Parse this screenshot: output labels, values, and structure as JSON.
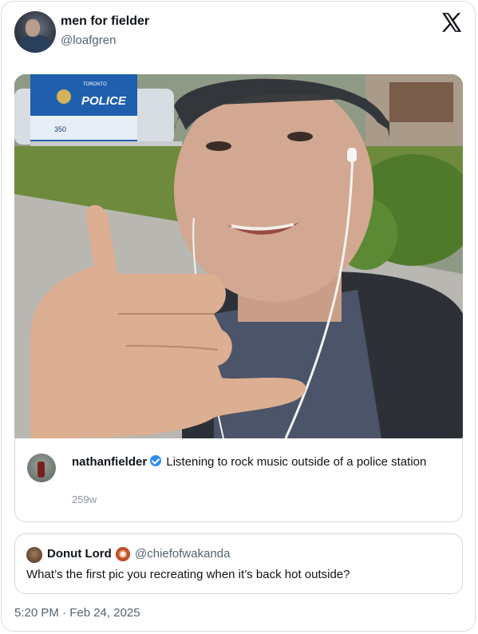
{
  "tweet": {
    "display_name": "men for fielder",
    "handle": "@loafgren",
    "timestamp": "5:20 PM · Feb 24, 2025"
  },
  "photo": {
    "sign_primary": "POLICE",
    "sign_small": "TORONTO",
    "sign_number": "350"
  },
  "embedded_post": {
    "username": "nathanfielder",
    "caption": "Listening to rock music outside of a police station",
    "age": "259w"
  },
  "quote": {
    "display_name": "Donut Lord",
    "handle": "@chiefofwakanda",
    "text": "What’s the first pic you recreating when it’s back hot outside?"
  },
  "icons": {
    "brand": "x-logo",
    "verified": "verified-badge-icon",
    "donut": "donut-emoji"
  },
  "colors": {
    "verified_blue": "#2f8df0",
    "secondary_text": "#536471",
    "border": "#cfd9de"
  }
}
